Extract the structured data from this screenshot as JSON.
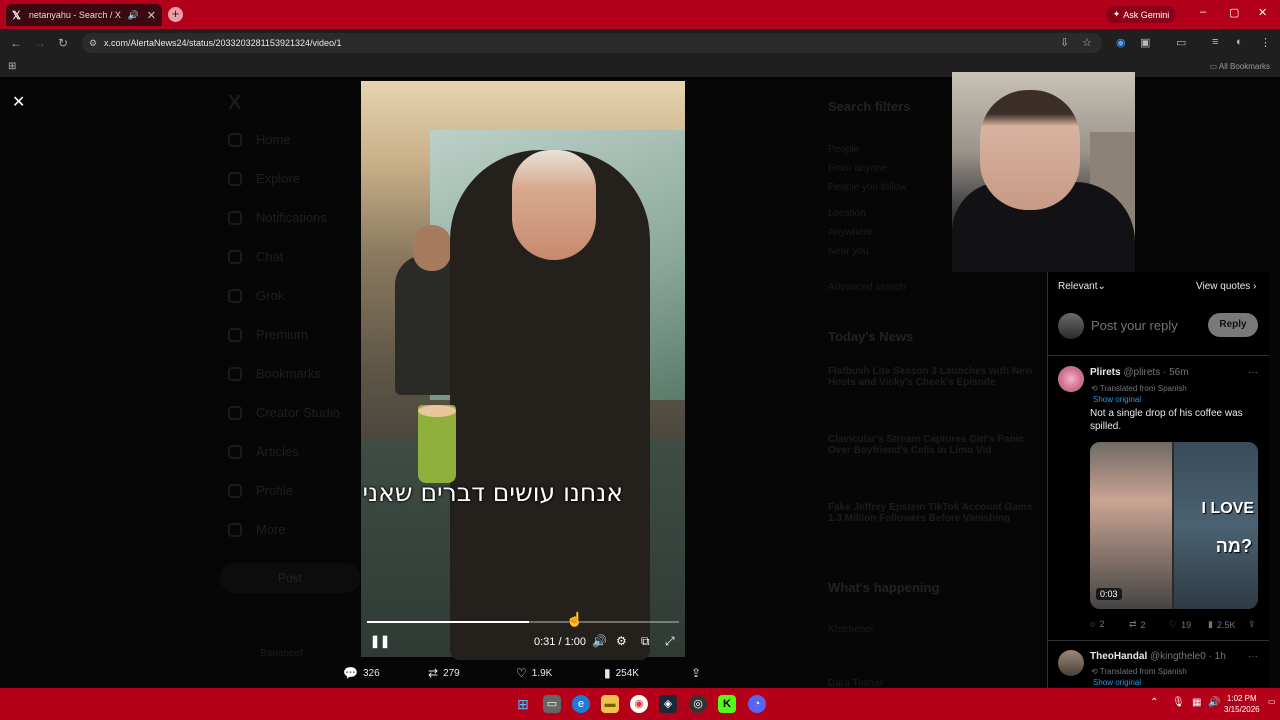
{
  "browser": {
    "tab_title": "netanyahu - Search / X",
    "tab_close": "✕",
    "new_tab": "+",
    "gemini": "Ask Gemini",
    "url": "x.com/AlertaNews24/status/2033203281153921324/video/1",
    "all_bookmarks": "All Bookmarks"
  },
  "window_controls": {
    "minimize": "–",
    "restore": "▢",
    "close": "✕"
  },
  "x_sidebar": {
    "logo": "X",
    "items": [
      "Home",
      "Explore",
      "Notifications",
      "Chat",
      "Grok",
      "Premium",
      "Bookmarks",
      "Creator Studio",
      "Articles",
      "Profile",
      "More"
    ],
    "post_button": "Post",
    "account_name": "Bananeef"
  },
  "search_filters": {
    "title": "Search filters",
    "people_label": "People",
    "people_options": [
      "From anyone",
      "People you follow"
    ],
    "location_label": "Location",
    "location_options": [
      "Anywhere",
      "Near you"
    ],
    "advanced": "Advanced search"
  },
  "news": {
    "title": "Today's News",
    "items": [
      "Flatbush Lite Season 3 Launches with New Hosts and Vicky's Cheek's Episode",
      "Clavicular's Stream Captures Girl's Panic Over Boyfriend's Calls in Limo Vid",
      "Fake Jeffrey Epstein TikTok Account Gains 1.3 Million Followers Before Vanishing"
    ]
  },
  "happening": {
    "title": "What's happening",
    "items": [
      "Khamenei",
      "Dara Tushar"
    ]
  },
  "video": {
    "subtitle": "אנחנו עושים דברים שאני",
    "current_time": "0:31",
    "duration": "1:00",
    "time_display": "0:31 / 1:00",
    "progress": 0.52
  },
  "post_actions": {
    "replies": "326",
    "reposts": "279",
    "likes": "1.9K",
    "views": "254K"
  },
  "replies_panel": {
    "sort": "Relevant",
    "view_quotes": "View quotes",
    "post_reply_placeholder": "Post your reply",
    "reply_button": "Reply",
    "tweets": [
      {
        "display_name": "Plirets",
        "handle": "@plirets",
        "time": "56m",
        "translated": "Translated from Spanish",
        "show_original": "Show original",
        "text": "Not a single drop of his coffee was spilled.",
        "media_overlay_1": "I LOVE",
        "media_overlay_2": "?מה",
        "media_duration": "0:03",
        "replies": "2",
        "reposts": "2",
        "likes": "19",
        "views": "2.5K"
      },
      {
        "display_name": "TheoHandal",
        "handle": "@kingthele0",
        "time": "1h",
        "translated": "Translated from Spanish",
        "show_original": "Show original"
      }
    ]
  },
  "taskbar": {
    "time": "1:02 PM",
    "date": "3/15/2026"
  },
  "colors": {
    "titlebar": "#b3001b",
    "taskbar": "#b5001a",
    "x_link": "#1d9bf0",
    "reply_button": "#787a7a"
  }
}
